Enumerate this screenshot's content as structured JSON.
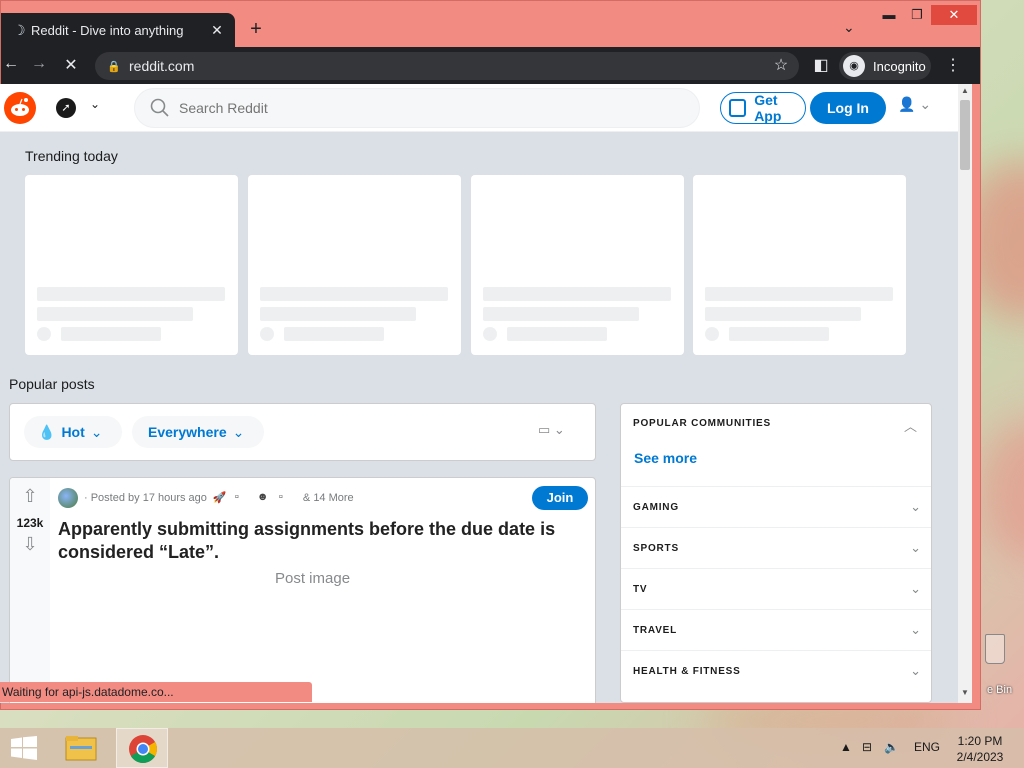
{
  "browser": {
    "tab_title": "Reddit - Dive into anything",
    "url": "reddit.com",
    "incognito_label": "Incognito",
    "status_text": "Waiting for api-js.datadome.co..."
  },
  "reddit": {
    "search_placeholder": "Search Reddit",
    "get_app": "Get App",
    "login": "Log In",
    "trending_title": "Trending today",
    "popular_title": "Popular posts",
    "sort": {
      "hot": "Hot",
      "everywhere": "Everywhere"
    },
    "post": {
      "votes": "123k",
      "meta": "· Posted by 17 hours ago",
      "more_awards": "& 14 More",
      "join": "Join",
      "title": "Apparently submitting assignments before the due date is considered “Late”.",
      "image_alt": "Post image"
    },
    "sidebar": {
      "header": "POPULAR COMMUNITIES",
      "see_more": "See more",
      "categories": [
        "GAMING",
        "SPORTS",
        "TV",
        "TRAVEL",
        "HEALTH & FITNESS"
      ]
    }
  },
  "taskbar": {
    "language": "ENG",
    "time": "1:20 PM",
    "date": "2/4/2023"
  },
  "desktop": {
    "recycle_label": "e Bin"
  },
  "colors": {
    "accent": "#0079d3",
    "reddit_orange": "#ff4500",
    "window_frame": "#f28b82"
  }
}
